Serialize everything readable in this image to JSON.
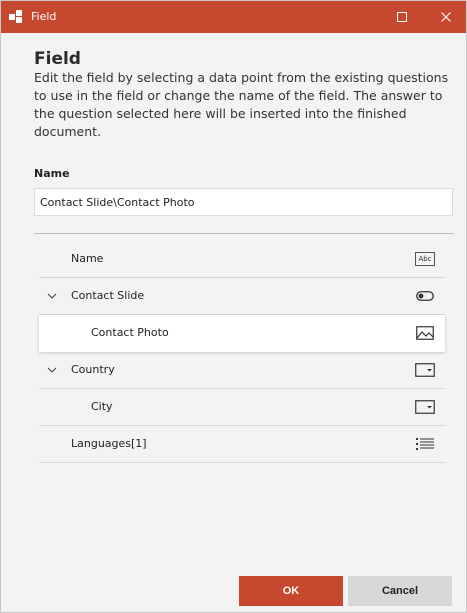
{
  "window": {
    "title": "Field",
    "accent_color": "#c5482f"
  },
  "dialog": {
    "heading": "Field",
    "description": "Edit the field by selecting a data point from the existing questions to use in the field or change the name of the field. The answer to the question selected here will be inserted into the finished document.",
    "name_label": "Name",
    "name_value": "Contact Slide\\Contact Photo"
  },
  "tree": [
    {
      "label": "Name",
      "level": 0,
      "expandable": false,
      "icon": "text-abc-icon",
      "icon_text": "Abc",
      "selected": false
    },
    {
      "label": "Contact Slide",
      "level": 0,
      "expandable": true,
      "icon": "toggle-icon",
      "selected": false
    },
    {
      "label": "Contact Photo",
      "level": 1,
      "expandable": false,
      "icon": "image-icon",
      "selected": true
    },
    {
      "label": "Country",
      "level": 0,
      "expandable": true,
      "icon": "dropdown-icon",
      "selected": false
    },
    {
      "label": "City",
      "level": 1,
      "expandable": false,
      "icon": "dropdown-icon",
      "selected": false
    },
    {
      "label": "Languages[1]",
      "level": 0,
      "expandable": false,
      "icon": "list-icon",
      "selected": false
    }
  ],
  "buttons": {
    "ok": "OK",
    "cancel": "Cancel"
  }
}
